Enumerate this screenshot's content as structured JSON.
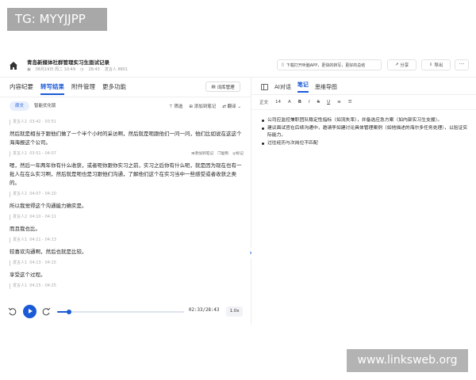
{
  "watermarks": {
    "tag": "TG: MYYJJPP",
    "site": "www.linksweb.org"
  },
  "header": {
    "title": "青岛新媒体社群管理实习生面试记录",
    "date": "08月19日 周二 10:49",
    "duration": "28:43",
    "speakers": "发言人 8801",
    "promo": "下载打开听脑APP，更快的转写，更好的总结",
    "share_label": "分享",
    "export_label": "导出",
    "more_label": "···"
  },
  "left_tabs": [
    "内容纪要",
    "转写结果",
    "附件管理",
    "更多功能"
  ],
  "vocab_label": "词库管理",
  "toolbar": {
    "original": "原文",
    "smart": "智能优化版",
    "filter": "筛选",
    "add_note": "添加到笔记",
    "translate": "翻译"
  },
  "transcript": [
    {
      "speaker": "发言人1",
      "time": "03:42 - 03:51",
      "text": "然后就是相当于跟他们做了一个半个小时的采访啊，然后就是呃跟他们一问一问，他们比如说在这这个海海报这个公司。"
    },
    {
      "speaker": "发言人1",
      "time": "03:51 - 04:07",
      "text": "嗯，然后一年两年你有什么收获，或者呃你跟你实习之前，实习之后你有什么呃，就是因为现在也有一批人在在么实习啊，然后就是呃也是习跟他们沟通，了解他们这个在实习当中一些感受或者收获之类的。",
      "actions": [
        "添加到笔记",
        "复制",
        "标记"
      ]
    },
    {
      "speaker": "发言人1",
      "time": "04:07 - 04:10",
      "text": "所以我觉得这个沟通能力确实是。"
    },
    {
      "speaker": "发言人2",
      "time": "04:10 - 04:11",
      "text": "而且我也比。"
    },
    {
      "speaker": "发言人1",
      "time": "04:11 - 04:13",
      "text": "较喜欢沟通啊，然后也就是比较。"
    },
    {
      "speaker": "发言人1",
      "time": "04:13 - 04:15",
      "text": "享受这个过程。"
    },
    {
      "speaker": "发言人1",
      "time": "04:15 - 04:25",
      "text": ""
    }
  ],
  "player": {
    "time": "02:33/28:43",
    "speed": "1.0x",
    "progress": 0.092
  },
  "right_tabs": [
    "AI对话",
    "笔记",
    "思维导图"
  ],
  "format_toolbar": [
    "正文",
    "14",
    "A",
    "B",
    "I",
    "S",
    "U",
    "≡",
    "☰"
  ],
  "notes": [
    "公司应监控兼职团队稳定性指标（如流失率），并备选应急方案（如内部实习生支援）。",
    "建议面试官在后续沟通中，邀请李如建讨论具体管理案例（如他描述的海尔多任务处理），以验证实际能力。",
    "过往经历与次岗位不匹配"
  ]
}
